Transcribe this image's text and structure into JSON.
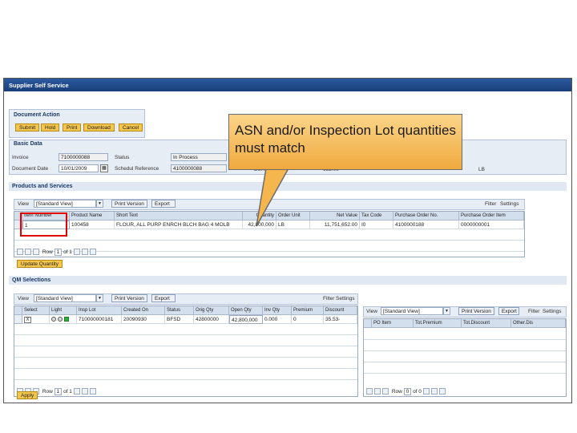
{
  "window": {
    "title": "Supplier Self Service"
  },
  "document_action": {
    "header": "Document Action",
    "buttons": [
      "Submit",
      "Hold",
      "Print",
      "Download",
      "Cancel"
    ]
  },
  "basic_data": {
    "header": "Basic Data",
    "invoice_label": "Invoice",
    "invoice_value": "7100000088",
    "status_label": "Status",
    "status_value": "In Process",
    "docdate_label": "Document Date",
    "docdate_value": "10/01/2009",
    "schedref_label": "Schedul Reference",
    "schedref_value": "4100000088",
    "hidden1": "EUR",
    "hidden2": "652.00",
    "hidden3": "LB"
  },
  "products": {
    "header": "Products and Services",
    "view_label": "View",
    "view_value": "[Standard View]",
    "print_label": "Print Version",
    "export_label": "Export",
    "filter_label": "Filter",
    "settings_label": "Settings",
    "columns": [
      "Item Number",
      "Product Name",
      "Short Text",
      "Quantity",
      "Order Unit",
      "Net Value",
      "Tax Code",
      "Purchase Order No.",
      "Purchase Order Item"
    ],
    "rows": [
      [
        "1",
        "100458",
        "FLOUR, ALL PURP ENRCH BLCH BAG 4 MOLB",
        "42,800,000",
        "LB",
        "11,751,652.00",
        "I0",
        "4100000188",
        "0000000001"
      ]
    ],
    "pager": {
      "row_label": "Row",
      "row_value": "1",
      "of_label": "of 1"
    },
    "update_button": "Update Quantity"
  },
  "qm": {
    "header": "QM Selections",
    "view_label": "View",
    "view_value": "[Standard View]",
    "print_label": "Print Version",
    "export_label": "Export",
    "filter_label": "Filter",
    "settings_label": "Settings",
    "columns": [
      "Select",
      "Light",
      "Insp Lot",
      "Created On",
      "Status",
      "Orig Qty",
      "Open Qty",
      "Inv Qty",
      "Premium",
      "Discount"
    ],
    "rows": [
      [
        "X",
        "",
        "710000000181",
        "20090930",
        "BFSD",
        "42800000",
        "42,800,000",
        "0.000",
        "0",
        "35.53-"
      ]
    ],
    "pager": {
      "row_label": "Row",
      "row_value": "1",
      "of_label": "of 1"
    },
    "apply_button": "Apply"
  },
  "right_panel": {
    "view_label": "View",
    "view_value": "[Standard View]",
    "print_label": "Print Version",
    "export_label": "Export",
    "filter_label": "Filter",
    "settings_label": "Settings",
    "columns": [
      "PO Item",
      "Tot.Premium",
      "Tot.Discount",
      "Other.Dis"
    ],
    "pager": {
      "row_label": "Row",
      "row_value": "0",
      "of_label": "of 0"
    }
  },
  "callout": {
    "text": "ASN and/or Inspection Lot quantities must match"
  },
  "colors": {
    "accent_button": "#f5c64e",
    "title_bar": "#2c5aa0",
    "callout_fill": "#f5b64e",
    "highlight_box": "#e00000",
    "status_green": "#2fae3a"
  }
}
